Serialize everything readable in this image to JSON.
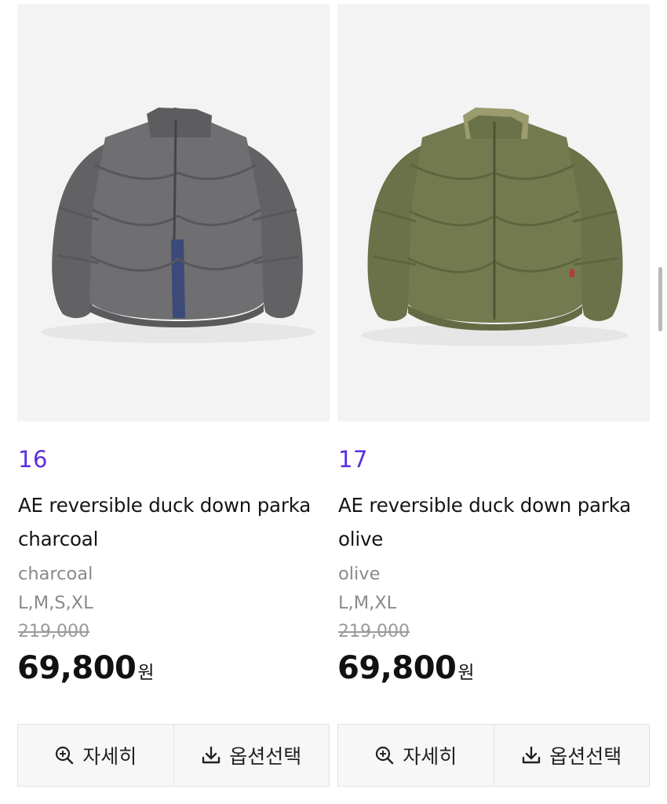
{
  "products": [
    {
      "rank": "16",
      "title": "AE reversible duck down parka charcoal",
      "color": "charcoal",
      "sizes": "L,M,S,XL",
      "original_price": "219,000",
      "price": "69,800",
      "currency": "원",
      "detail_label": "자세히",
      "option_label": "옵션선택",
      "image_icon": "charcoal-down-jacket-image",
      "colors": {
        "body": "#6f6e70",
        "shade": "#58575a",
        "lining": "#3b4a78",
        "bg": "#f3f3f3"
      }
    },
    {
      "rank": "17",
      "title": "AE reversible duck down parka olive",
      "color": "olive",
      "sizes": "L,M,XL",
      "original_price": "219,000",
      "price": "69,800",
      "currency": "원",
      "detail_label": "자세히",
      "option_label": "옵션선택",
      "image_icon": "olive-down-jacket-image",
      "colors": {
        "body": "#747a4f",
        "shade": "#5f6440",
        "lining": "#9a9b6f",
        "bg": "#f3f3f3"
      }
    }
  ],
  "accent_color": "#5b2ee0"
}
